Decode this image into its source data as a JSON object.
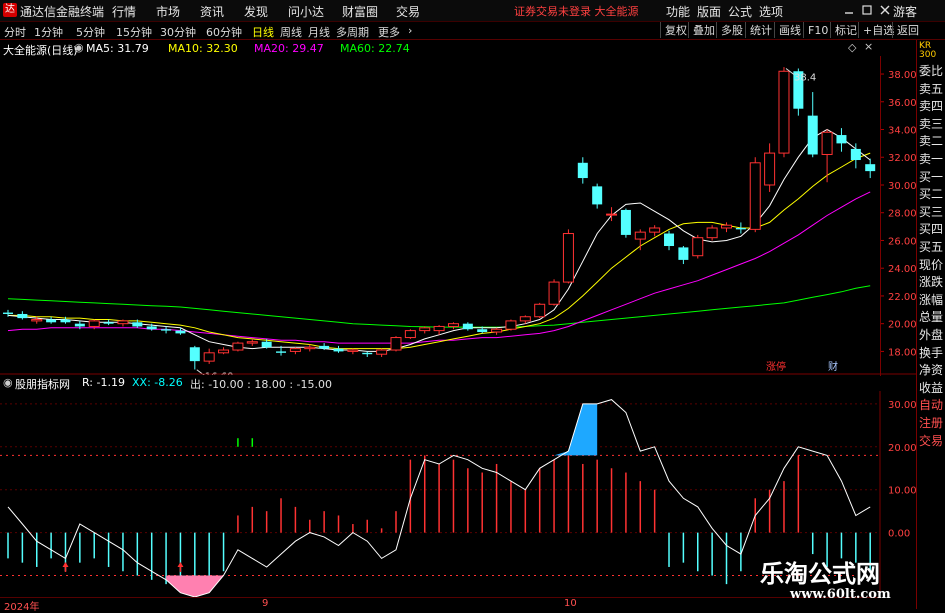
{
  "menubar": {
    "app_title": "通达信金融终端",
    "logo_glyph": "达",
    "items": [
      "行情",
      "市场",
      "资讯",
      "发现",
      "问小达",
      "财富圈",
      "交易"
    ],
    "notice": "证券交易未登录  大全能源",
    "tools": [
      "功能",
      "版面",
      "公式",
      "选项"
    ],
    "guest": "游客"
  },
  "periods": [
    "分时",
    "1分钟",
    "5分钟",
    "15分钟",
    "30分钟",
    "60分钟",
    "日线",
    "周线",
    "月线",
    "多周期",
    "更多"
  ],
  "active_period": "日线",
  "right_tools": [
    "复权",
    "叠加",
    "多股",
    "统计",
    "画线",
    "F10",
    "标记",
    "+自选",
    "返回"
  ],
  "stock": {
    "name": "大全能源(日线)",
    "ma5": "MA5: 31.79",
    "ma10": "MA10: 32.30",
    "ma20": "MA20: 29.47",
    "ma60": "MA60: 22.74",
    "ma_colors": {
      "ma5": "#ffffff",
      "ma10": "#ffff00",
      "ma20": "#ff00ff",
      "ma60": "#00ff00"
    }
  },
  "sidebar": [
    "委比",
    "卖五",
    "卖四",
    "卖三",
    "卖二",
    "卖一",
    "买一",
    "买二",
    "买三",
    "买四",
    "买五",
    "现价",
    "涨跌",
    "涨幅",
    "总量",
    "外盘",
    "换手",
    "净资",
    "收益",
    "自动",
    "注册",
    "交易"
  ],
  "sidebar_top": "KR 300",
  "sub": {
    "name": "股朋指标网",
    "r": "R: -1.19",
    "xx": "XX: -8.26",
    "out": "出: -10.00 : 18.00 : -15.00",
    "out_prefix": "出"
  },
  "dates": [
    "2024年",
    "9",
    "10"
  ],
  "watermark": {
    "line1": "乐淘公式网",
    "line2": "www.60lt.com"
  },
  "markers": {
    "zhangting": "涨停",
    "cai": "财"
  },
  "chart_data": {
    "type": "candlestick",
    "title": "大全能源(日线)",
    "y_ticks": [
      18,
      20,
      22,
      24,
      26,
      28,
      30,
      32,
      34,
      36,
      38
    ],
    "ylim": [
      16.3,
      39.3
    ],
    "annotations": [
      {
        "text": "16.68",
        "value": 16.68
      },
      {
        "text": "38.4",
        "value": 38.4
      }
    ],
    "candles": [
      [
        20.8,
        21.0,
        20.5,
        20.7
      ],
      [
        20.7,
        20.9,
        20.3,
        20.4
      ],
      [
        20.2,
        20.5,
        20.0,
        20.3
      ],
      [
        20.3,
        20.5,
        20.0,
        20.1
      ],
      [
        20.3,
        20.5,
        20.0,
        20.1
      ],
      [
        20.0,
        20.2,
        19.6,
        19.8
      ],
      [
        19.8,
        20.3,
        19.6,
        20.2
      ],
      [
        20.1,
        20.3,
        19.9,
        20.0
      ],
      [
        20.0,
        20.3,
        19.8,
        20.2
      ],
      [
        20.1,
        20.3,
        19.7,
        19.8
      ],
      [
        19.8,
        20.0,
        19.5,
        19.6
      ],
      [
        19.6,
        19.8,
        19.3,
        19.5
      ],
      [
        19.5,
        19.7,
        19.2,
        19.3
      ],
      [
        18.3,
        18.4,
        16.7,
        17.3
      ],
      [
        17.3,
        18.2,
        17.1,
        17.9
      ],
      [
        17.9,
        18.3,
        17.8,
        18.1
      ],
      [
        18.1,
        18.7,
        18.0,
        18.6
      ],
      [
        18.6,
        18.9,
        18.4,
        18.7
      ],
      [
        18.7,
        18.9,
        18.2,
        18.3
      ],
      [
        18.0,
        18.4,
        17.7,
        17.9
      ],
      [
        18.0,
        18.3,
        17.8,
        18.2
      ],
      [
        18.2,
        18.5,
        18.0,
        18.3
      ],
      [
        18.4,
        18.6,
        18.1,
        18.2
      ],
      [
        18.2,
        18.4,
        17.9,
        18.0
      ],
      [
        18.0,
        18.2,
        17.8,
        18.1
      ],
      [
        17.9,
        18.0,
        17.6,
        17.8
      ],
      [
        17.8,
        18.2,
        17.6,
        18.1
      ],
      [
        18.1,
        19.1,
        18.0,
        19.0
      ],
      [
        19.0,
        19.6,
        18.9,
        19.5
      ],
      [
        19.5,
        19.8,
        19.3,
        19.7
      ],
      [
        19.5,
        19.9,
        19.2,
        19.8
      ],
      [
        19.8,
        20.1,
        19.6,
        20.0
      ],
      [
        20.0,
        20.1,
        19.5,
        19.6
      ],
      [
        19.6,
        19.8,
        19.3,
        19.4
      ],
      [
        19.4,
        19.7,
        19.2,
        19.6
      ],
      [
        19.6,
        20.3,
        19.5,
        20.2
      ],
      [
        20.2,
        20.6,
        20.0,
        20.5
      ],
      [
        20.5,
        21.5,
        20.4,
        21.4
      ],
      [
        21.4,
        23.2,
        21.3,
        23.0
      ],
      [
        23.0,
        26.8,
        22.9,
        26.5
      ],
      [
        31.6,
        32.0,
        30.1,
        30.5
      ],
      [
        29.9,
        30.1,
        28.3,
        28.6
      ],
      [
        27.9,
        28.4,
        27.4,
        27.9
      ],
      [
        28.2,
        28.3,
        26.2,
        26.4
      ],
      [
        26.1,
        26.8,
        25.3,
        26.6
      ],
      [
        26.6,
        27.1,
        26.3,
        26.9
      ],
      [
        26.5,
        26.7,
        25.3,
        25.6
      ],
      [
        25.5,
        25.6,
        24.3,
        24.6
      ],
      [
        24.9,
        26.4,
        24.7,
        26.2
      ],
      [
        26.2,
        27.1,
        26.0,
        26.9
      ],
      [
        26.9,
        27.3,
        26.6,
        27.1
      ],
      [
        26.9,
        27.3,
        26.5,
        26.8
      ],
      [
        26.8,
        32.0,
        26.6,
        31.6
      ],
      [
        30.0,
        33.0,
        29.5,
        32.3
      ],
      [
        32.3,
        38.5,
        32.0,
        38.2
      ],
      [
        38.2,
        38.4,
        35.0,
        35.5
      ],
      [
        35.0,
        36.7,
        32.0,
        32.2
      ],
      [
        32.2,
        34.0,
        30.2,
        33.8
      ],
      [
        33.6,
        34.1,
        32.4,
        33.0
      ],
      [
        32.6,
        33.0,
        31.2,
        31.8
      ],
      [
        31.5,
        31.9,
        30.5,
        31.0
      ]
    ],
    "ma5": [
      20.6,
      20.5,
      20.4,
      20.3,
      20.3,
      20.2,
      20.1,
      20.1,
      20.1,
      20.0,
      19.9,
      19.8,
      19.7,
      19.2,
      18.7,
      18.5,
      18.3,
      18.2,
      18.3,
      18.3,
      18.3,
      18.3,
      18.2,
      18.1,
      18.1,
      18.0,
      18.0,
      18.2,
      18.5,
      18.9,
      19.2,
      19.5,
      19.7,
      19.7,
      19.7,
      19.8,
      20.0,
      20.3,
      21.0,
      22.5,
      24.5,
      26.5,
      27.8,
      28.6,
      28.7,
      28.1,
      27.5,
      26.7,
      26.1,
      25.9,
      26.0,
      26.3,
      27.2,
      28.5,
      30.4,
      32.0,
      33.4,
      34.0,
      33.4,
      32.6,
      31.8
    ],
    "ma10": [
      20.6,
      20.6,
      20.5,
      20.5,
      20.4,
      20.4,
      20.3,
      20.3,
      20.2,
      20.2,
      20.1,
      20.0,
      19.9,
      19.7,
      19.4,
      19.2,
      19.0,
      18.9,
      18.8,
      18.7,
      18.6,
      18.5,
      18.3,
      18.2,
      18.2,
      18.2,
      18.2,
      18.2,
      18.3,
      18.5,
      18.7,
      18.9,
      19.1,
      19.3,
      19.4,
      19.6,
      19.8,
      20.0,
      20.4,
      21.1,
      22.0,
      23.0,
      24.0,
      24.8,
      25.6,
      26.2,
      26.8,
      27.2,
      27.3,
      27.3,
      27.1,
      26.9,
      26.9,
      27.3,
      28.2,
      29.0,
      29.9,
      30.7,
      31.3,
      31.9,
      32.3
    ],
    "ma20": [
      19.5,
      19.6,
      19.6,
      19.7,
      19.7,
      19.7,
      19.7,
      19.7,
      19.7,
      19.7,
      19.6,
      19.6,
      19.5,
      19.4,
      19.3,
      19.2,
      19.1,
      19.0,
      18.9,
      18.8,
      18.8,
      18.7,
      18.7,
      18.6,
      18.6,
      18.6,
      18.6,
      18.6,
      18.6,
      18.7,
      18.8,
      18.8,
      18.9,
      19.0,
      19.0,
      19.1,
      19.2,
      19.3,
      19.5,
      19.8,
      20.2,
      20.6,
      21.0,
      21.4,
      21.8,
      22.2,
      22.5,
      22.8,
      23.1,
      23.5,
      23.9,
      24.3,
      24.7,
      25.2,
      25.8,
      26.4,
      27.1,
      27.8,
      28.4,
      29.0,
      29.5
    ],
    "ma60": [
      21.8,
      21.75,
      21.7,
      21.65,
      21.6,
      21.55,
      21.5,
      21.45,
      21.4,
      21.35,
      21.3,
      21.25,
      21.2,
      21.1,
      21.0,
      20.9,
      20.8,
      20.7,
      20.6,
      20.5,
      20.4,
      20.3,
      20.2,
      20.1,
      20.0,
      19.95,
      19.9,
      19.85,
      19.8,
      19.78,
      19.75,
      19.75,
      19.75,
      19.75,
      19.75,
      19.75,
      19.8,
      19.85,
      19.9,
      20.0,
      20.1,
      20.2,
      20.3,
      20.4,
      20.5,
      20.6,
      20.7,
      20.8,
      20.9,
      21.0,
      21.1,
      21.2,
      21.3,
      21.4,
      21.5,
      21.7,
      21.9,
      22.1,
      22.3,
      22.55,
      22.74
    ],
    "sub_ticks": [
      30,
      20,
      10,
      0
    ],
    "sub_right_labels": [
      "30.00",
      "20.00",
      "10.00",
      "0.00"
    ],
    "sub_ylim": [
      -15,
      33
    ],
    "sub_line": [
      6,
      2,
      -2,
      -4,
      -6,
      2,
      0,
      -2,
      -4,
      -7,
      -9,
      -11,
      -14,
      -15,
      -14,
      -10,
      -4,
      -6,
      -8,
      -5,
      -2,
      0,
      -1,
      -3,
      0,
      -2,
      -6,
      -4,
      8,
      17,
      16,
      18,
      17,
      15,
      14,
      12,
      10,
      15,
      17,
      19,
      30,
      30,
      31,
      28,
      19,
      20,
      12,
      8,
      6,
      1,
      -3,
      -5,
      4,
      8,
      15,
      20,
      19,
      18,
      12,
      4,
      6
    ],
    "sub_bars": [
      -6,
      -7,
      -8,
      -6,
      -9,
      -7,
      -6,
      -8,
      -9,
      -10,
      -11,
      -12,
      -10,
      -13,
      -12,
      -9,
      4,
      6,
      5,
      8,
      6,
      3,
      5,
      4,
      2,
      3,
      1,
      5,
      17,
      18,
      16,
      17,
      15,
      14,
      16,
      12,
      10,
      15,
      17,
      18,
      16,
      17,
      15,
      14,
      12,
      10,
      -8,
      -7,
      -9,
      -10,
      -12,
      -9,
      8,
      10,
      12,
      18,
      -5,
      -8,
      -6,
      -7,
      -9
    ],
    "up_markers": [
      4,
      12
    ]
  }
}
